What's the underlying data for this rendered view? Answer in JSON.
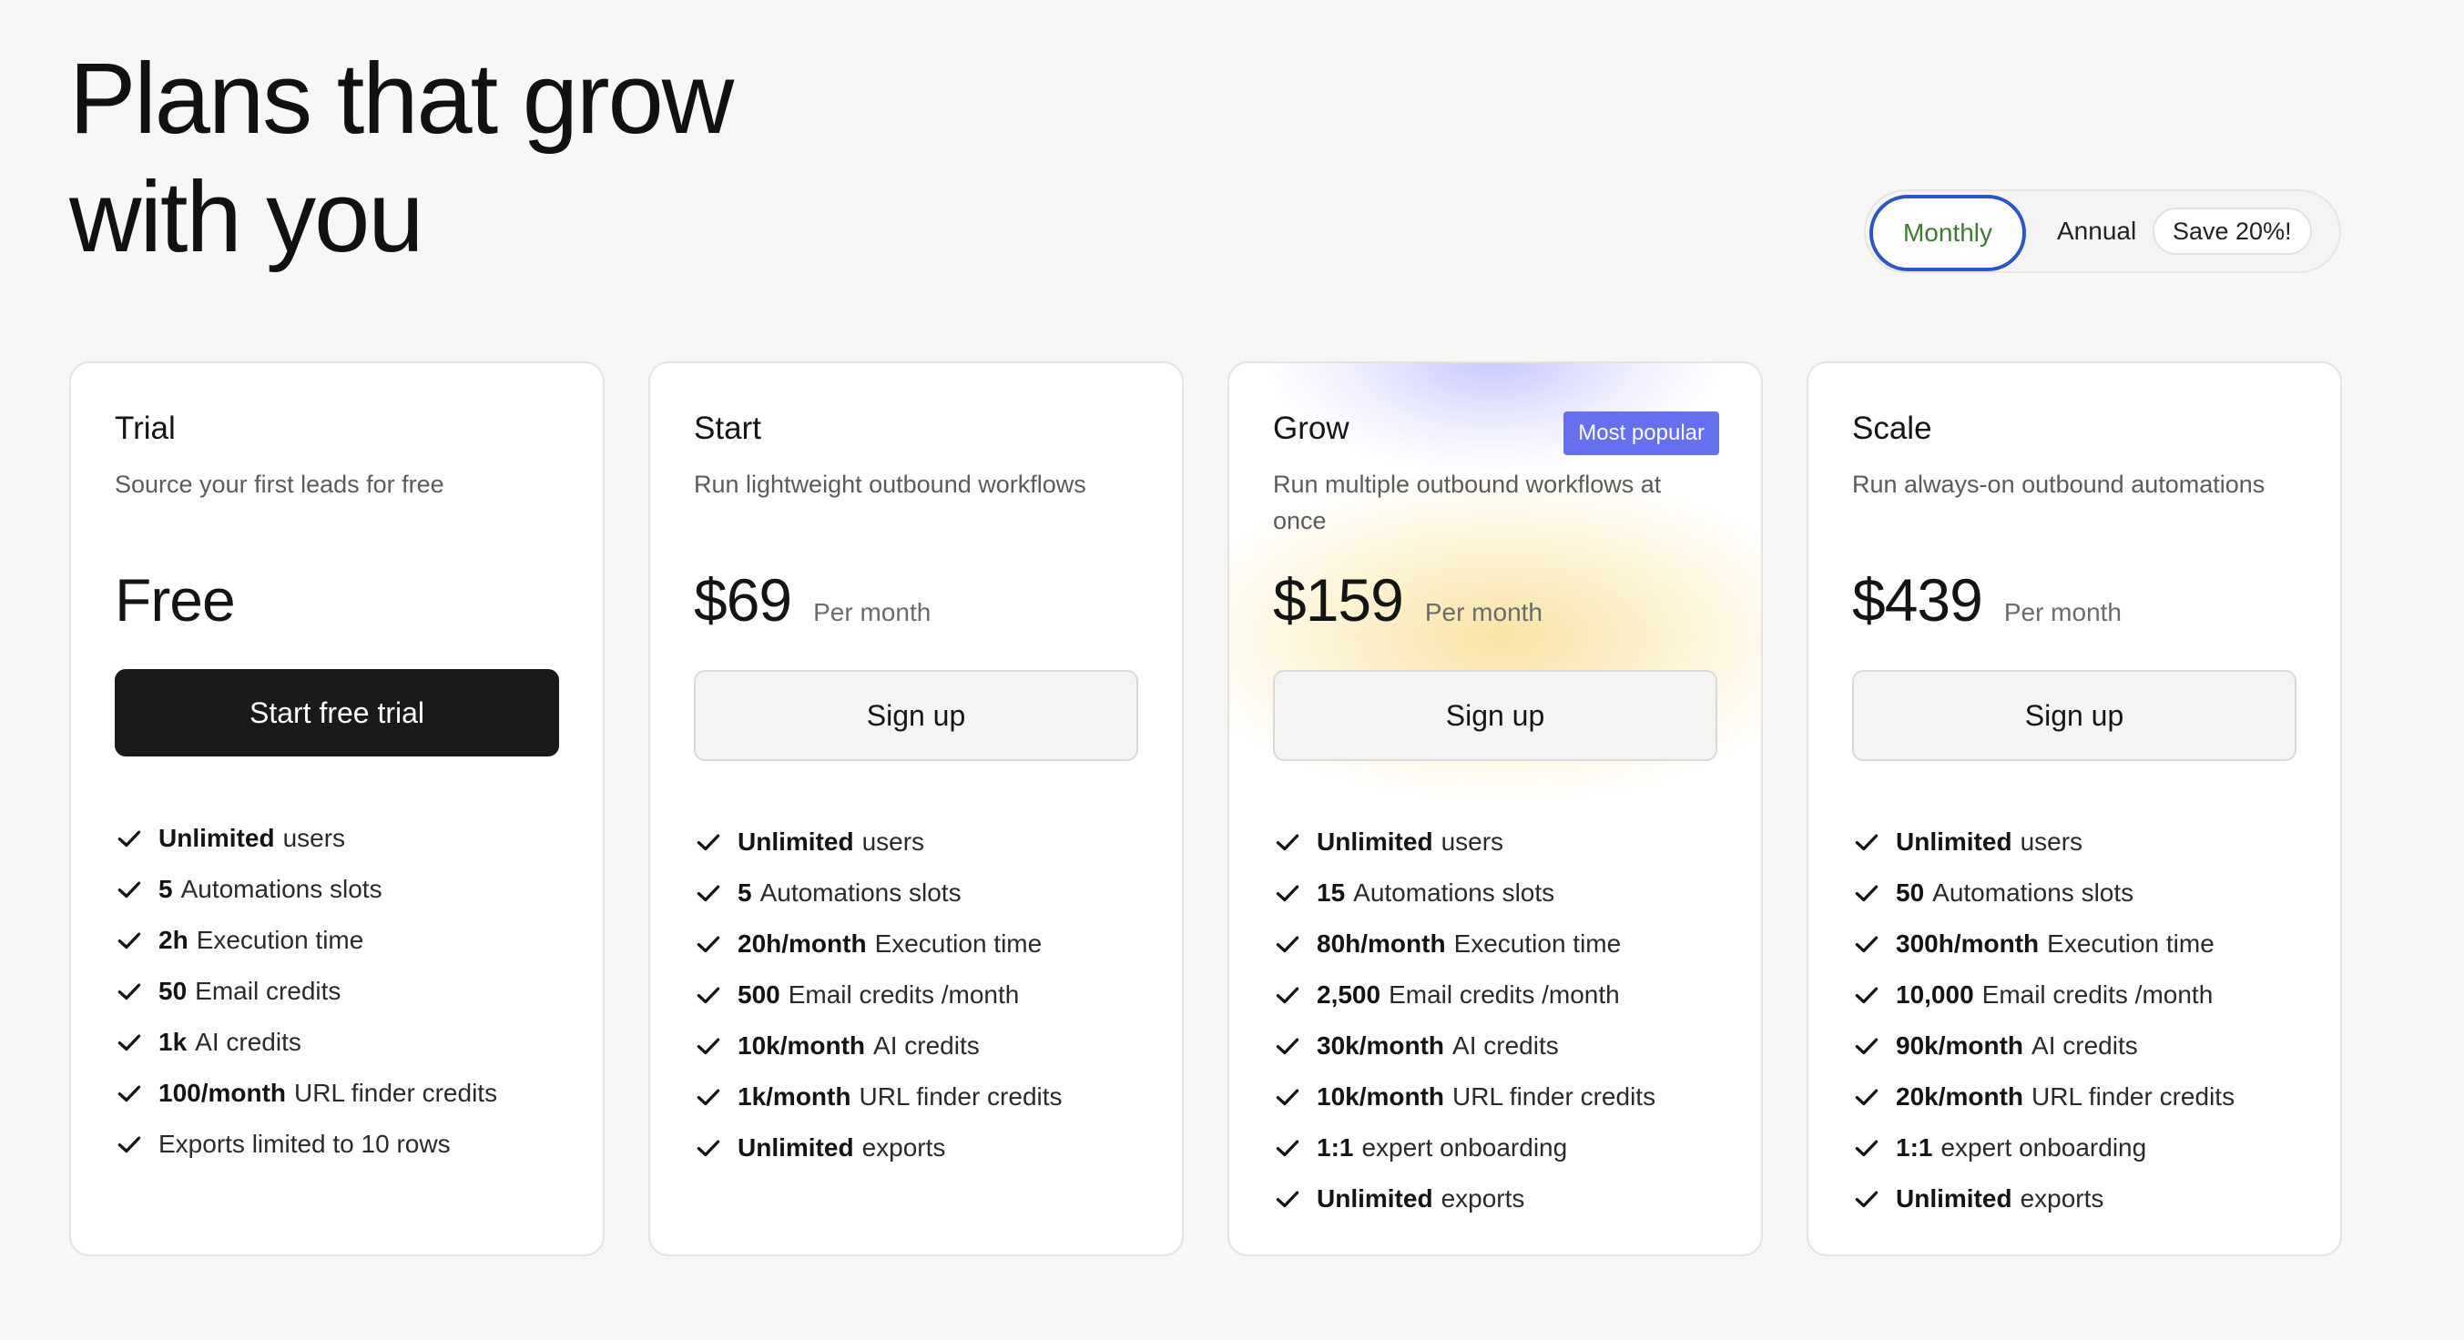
{
  "header": {
    "title_line1": "Plans that grow",
    "title_line2": "with you"
  },
  "billing_toggle": {
    "monthly_label": "Monthly",
    "annual_label": "Annual",
    "save_badge": "Save 20%!",
    "selected": "Monthly"
  },
  "colors": {
    "accent_blue": "#2a56c6",
    "monthly_text": "#3e7a32",
    "popular_badge": "#6470ee",
    "dark_button": "#1b1a18"
  },
  "plans": [
    {
      "name": "Trial",
      "description": "Source your first leads for free",
      "price": "Free",
      "price_suffix": "",
      "cta": "Start free trial",
      "badge": "",
      "features": [
        {
          "strong": "Unlimited",
          "text": "users"
        },
        {
          "strong": "5",
          "text": "Automations slots"
        },
        {
          "strong": "2h",
          "text": "Execution time"
        },
        {
          "strong": "50",
          "text": "Email credits"
        },
        {
          "strong": "1k",
          "text": "AI credits"
        },
        {
          "strong": "100/month",
          "text": "URL finder credits"
        },
        {
          "strong": "",
          "text": "Exports limited to 10 rows"
        }
      ]
    },
    {
      "name": "Start",
      "description": "Run lightweight outbound workflows",
      "price": "$69",
      "price_suffix": "Per month",
      "cta": "Sign up",
      "badge": "",
      "features": [
        {
          "strong": "Unlimited",
          "text": "users"
        },
        {
          "strong": "5",
          "text": "Automations slots"
        },
        {
          "strong": "20h/month",
          "text": "Execution time"
        },
        {
          "strong": "500",
          "text": "Email credits /month"
        },
        {
          "strong": "10k/month",
          "text": "AI credits"
        },
        {
          "strong": "1k/month",
          "text": "URL finder credits"
        },
        {
          "strong": "Unlimited",
          "text": "exports"
        }
      ]
    },
    {
      "name": "Grow",
      "description": "Run multiple outbound workflows at once",
      "price": "$159",
      "price_suffix": "Per month",
      "cta": "Sign up",
      "badge": "Most popular",
      "features": [
        {
          "strong": "Unlimited",
          "text": "users"
        },
        {
          "strong": "15",
          "text": "Automations slots"
        },
        {
          "strong": "80h/month",
          "text": "Execution time"
        },
        {
          "strong": "2,500",
          "text": "Email credits /month"
        },
        {
          "strong": "30k/month",
          "text": "AI credits"
        },
        {
          "strong": "10k/month",
          "text": "URL finder credits"
        },
        {
          "strong": "1:1",
          "text": "expert onboarding"
        },
        {
          "strong": "Unlimited",
          "text": "exports"
        }
      ]
    },
    {
      "name": "Scale",
      "description": "Run always-on outbound automations",
      "price": "$439",
      "price_suffix": "Per month",
      "cta": "Sign up",
      "badge": "",
      "features": [
        {
          "strong": "Unlimited",
          "text": "users"
        },
        {
          "strong": "50",
          "text": "Automations slots"
        },
        {
          "strong": "300h/month",
          "text": "Execution time"
        },
        {
          "strong": "10,000",
          "text": "Email credits /month"
        },
        {
          "strong": "90k/month",
          "text": "AI credits"
        },
        {
          "strong": "20k/month",
          "text": "URL finder credits"
        },
        {
          "strong": "1:1",
          "text": "expert onboarding"
        },
        {
          "strong": "Unlimited",
          "text": "exports"
        }
      ]
    }
  ]
}
